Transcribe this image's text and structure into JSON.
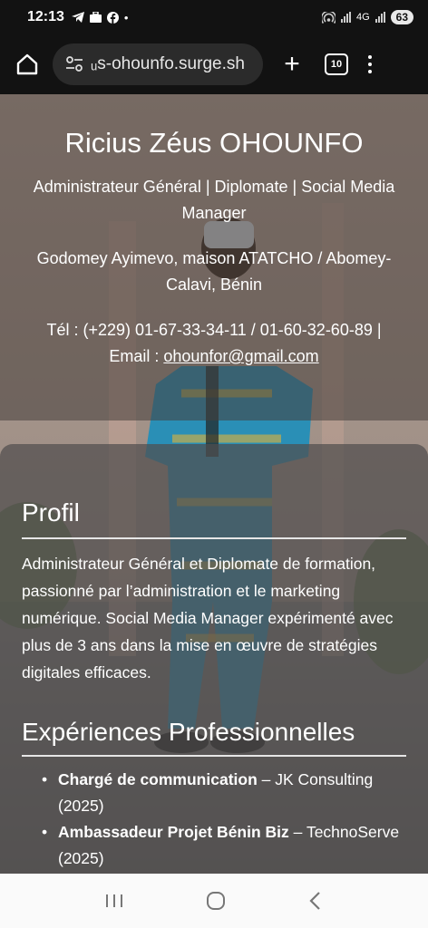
{
  "status_bar": {
    "time": "12:13",
    "left_icons": [
      "telegram-icon",
      "briefcase-icon",
      "facebook-icon",
      "dot-icon"
    ],
    "right_icons": [
      "hotspot-icon",
      "signal-icon",
      "4g-signal-icon"
    ],
    "network_label": "4G",
    "battery": "63"
  },
  "browser": {
    "url": "ᵤs-ohounfo.surge.sh",
    "tab_count": "10"
  },
  "page": {
    "name": "Ricius Zéus OHOUNFO",
    "tagline": "Administrateur Général | Diplomate | Social Media Manager",
    "address": "Godomey Ayimevo, maison ATATCHO / Abomey-Calavi, Bénin",
    "phone_text": "Tél : (+229) 01-67-33-34-11 / 01-60-32-60-89 |",
    "email_label": "Email : ",
    "email": "ohounfor@gmail.com",
    "profil_heading": "Profil",
    "profil_text": "Administrateur Général et Diplomate de formation, passionné par l’administration et le marketing numérique. Social Media Manager expérimenté avec plus de 3 ans dans la mise en œuvre de stratégies digitales efficaces.",
    "experience_heading": "Expériences Professionnelles",
    "experiences": [
      {
        "title": "Chargé de communication",
        "rest": " – JK Consulting (2025)"
      },
      {
        "title": "Ambassadeur Projet Bénin Biz",
        "rest": " – TechnoServe (2025)"
      }
    ]
  },
  "colors": {
    "toolbar_bg": "#121212",
    "url_bar_bg": "#2b2b2b",
    "nav_bg": "#fafafa"
  }
}
